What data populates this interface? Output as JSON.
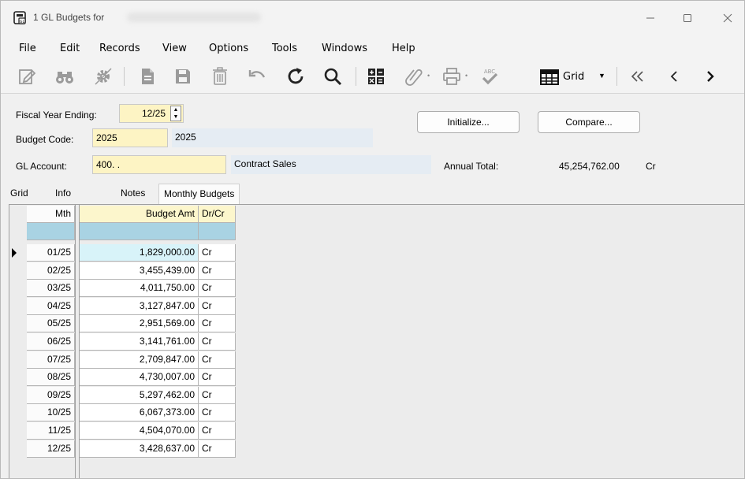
{
  "window": {
    "title": "1 GL Budgets for",
    "controls": [
      "minimize-icon",
      "maximize-icon",
      "close-icon"
    ]
  },
  "menu": [
    "File",
    "Edit",
    "Records",
    "View",
    "Options",
    "Tools",
    "Windows",
    "Help"
  ],
  "toolbar": {
    "icons": [
      "edit-icon",
      "binoculars-icon",
      "gear-icon",
      "document-icon",
      "save-icon",
      "delete-icon",
      "undo-icon",
      "refresh-icon",
      "search-icon",
      "calculator-icon",
      "paperclip-icon",
      "printer-icon",
      "spellcheck-icon",
      "grid-icon",
      "first-record-icon",
      "previous-record-icon",
      "next-record-icon"
    ],
    "grid_label": "Grid"
  },
  "form": {
    "fiscal_year_label": "Fiscal Year Ending:",
    "fiscal_year_value": "12/25",
    "budget_code_label": "Budget Code:",
    "budget_code_value": "2025",
    "budget_code_desc": "2025",
    "gl_account_label": "GL Account:",
    "gl_account_value": "400.  .",
    "gl_account_desc": "Contract Sales",
    "annual_total_label": "Annual Total:",
    "annual_total_value": "45,254,762.00",
    "annual_total_drcr": "Cr",
    "initialize_label": "Initialize...",
    "compare_label": "Compare..."
  },
  "tabs": [
    "Grid",
    "Info",
    "Notes",
    "Monthly Budgets"
  ],
  "active_tab": "Monthly Budgets",
  "grid": {
    "columns": [
      "Mth",
      "Budget Amt",
      "Dr/Cr"
    ],
    "rows": [
      {
        "mth": "01/25",
        "amt": "1,829,000.00",
        "drcr": "Cr"
      },
      {
        "mth": "02/25",
        "amt": "3,455,439.00",
        "drcr": "Cr"
      },
      {
        "mth": "03/25",
        "amt": "4,011,750.00",
        "drcr": "Cr"
      },
      {
        "mth": "04/25",
        "amt": "3,127,847.00",
        "drcr": "Cr"
      },
      {
        "mth": "05/25",
        "amt": "2,951,569.00",
        "drcr": "Cr"
      },
      {
        "mth": "06/25",
        "amt": "3,141,761.00",
        "drcr": "Cr"
      },
      {
        "mth": "07/25",
        "amt": "2,709,847.00",
        "drcr": "Cr"
      },
      {
        "mth": "08/25",
        "amt": "4,730,007.00",
        "drcr": "Cr"
      },
      {
        "mth": "09/25",
        "amt": "5,297,462.00",
        "drcr": "Cr"
      },
      {
        "mth": "10/25",
        "amt": "6,067,373.00",
        "drcr": "Cr"
      },
      {
        "mth": "11/25",
        "amt": "4,504,070.00",
        "drcr": "Cr"
      },
      {
        "mth": "12/25",
        "amt": "3,428,637.00",
        "drcr": "Cr"
      }
    ]
  },
  "colors": {
    "header_yellow": "#fcf6cc",
    "filter_blue": "#a9d3e3",
    "selected_cell": "#d8f3f9",
    "field_yellow": "#fdf4c4",
    "field_blue": "#e5ecf3"
  }
}
